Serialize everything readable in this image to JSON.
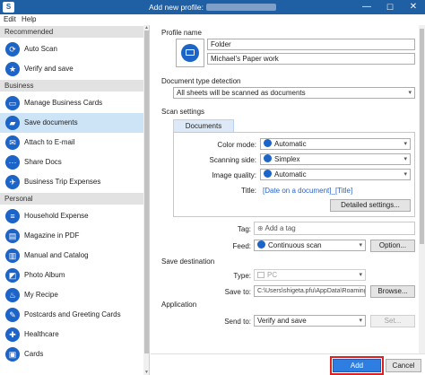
{
  "window": {
    "title": "Add new profile:",
    "minimize": "—",
    "maximize": "☐",
    "close": "✕"
  },
  "menu": {
    "edit": "Edit",
    "help": "Help"
  },
  "sidebar": {
    "categories": [
      "Recommended",
      "Business",
      "Personal"
    ],
    "items": [
      {
        "label": "Auto Scan"
      },
      {
        "label": "Verify and save"
      },
      {
        "label": "Manage Business Cards"
      },
      {
        "label": "Save documents"
      },
      {
        "label": "Attach to E-mail"
      },
      {
        "label": "Share Docs"
      },
      {
        "label": "Business Trip Expenses"
      },
      {
        "label": "Household Expense"
      },
      {
        "label": "Magazine in PDF"
      },
      {
        "label": "Manual and Catalog"
      },
      {
        "label": "Photo Album"
      },
      {
        "label": "My Recipe"
      },
      {
        "label": "Postcards and Greeting Cards"
      },
      {
        "label": "Healthcare"
      },
      {
        "label": "Cards"
      }
    ]
  },
  "profile": {
    "section": "Profile name",
    "name": "Folder",
    "description": "Michael's Paper work"
  },
  "doc_type": {
    "section": "Document type detection",
    "value": "All sheets will be scanned as documents"
  },
  "scan_settings": {
    "section": "Scan settings",
    "tab": "Documents",
    "color_mode_label": "Color mode:",
    "color_mode_value": "Automatic",
    "scanning_side_label": "Scanning side:",
    "scanning_side_value": "Simplex",
    "image_quality_label": "Image quality:",
    "image_quality_value": "Automatic",
    "title_label": "Title:",
    "title_value": "[Date on a document]_[Title]",
    "detailed_button": "Detailed settings..."
  },
  "tag": {
    "label": "Tag:",
    "placeholder": "Add a tag"
  },
  "feed": {
    "label": "Feed:",
    "value": "Continuous scan",
    "option_button": "Option..."
  },
  "save_destination": {
    "section": "Save destination",
    "type_label": "Type:",
    "type_value": "PC",
    "save_to_label": "Save to:",
    "save_to_value": "C:\\Users\\shigeta.pfu\\AppData\\Roaming\\PF",
    "browse_button": "Browse..."
  },
  "application": {
    "section": "Application",
    "send_to_label": "Send to:",
    "send_to_value": "Verify and save",
    "set_button": "Set..."
  },
  "footer": {
    "add": "Add",
    "cancel": "Cancel"
  }
}
